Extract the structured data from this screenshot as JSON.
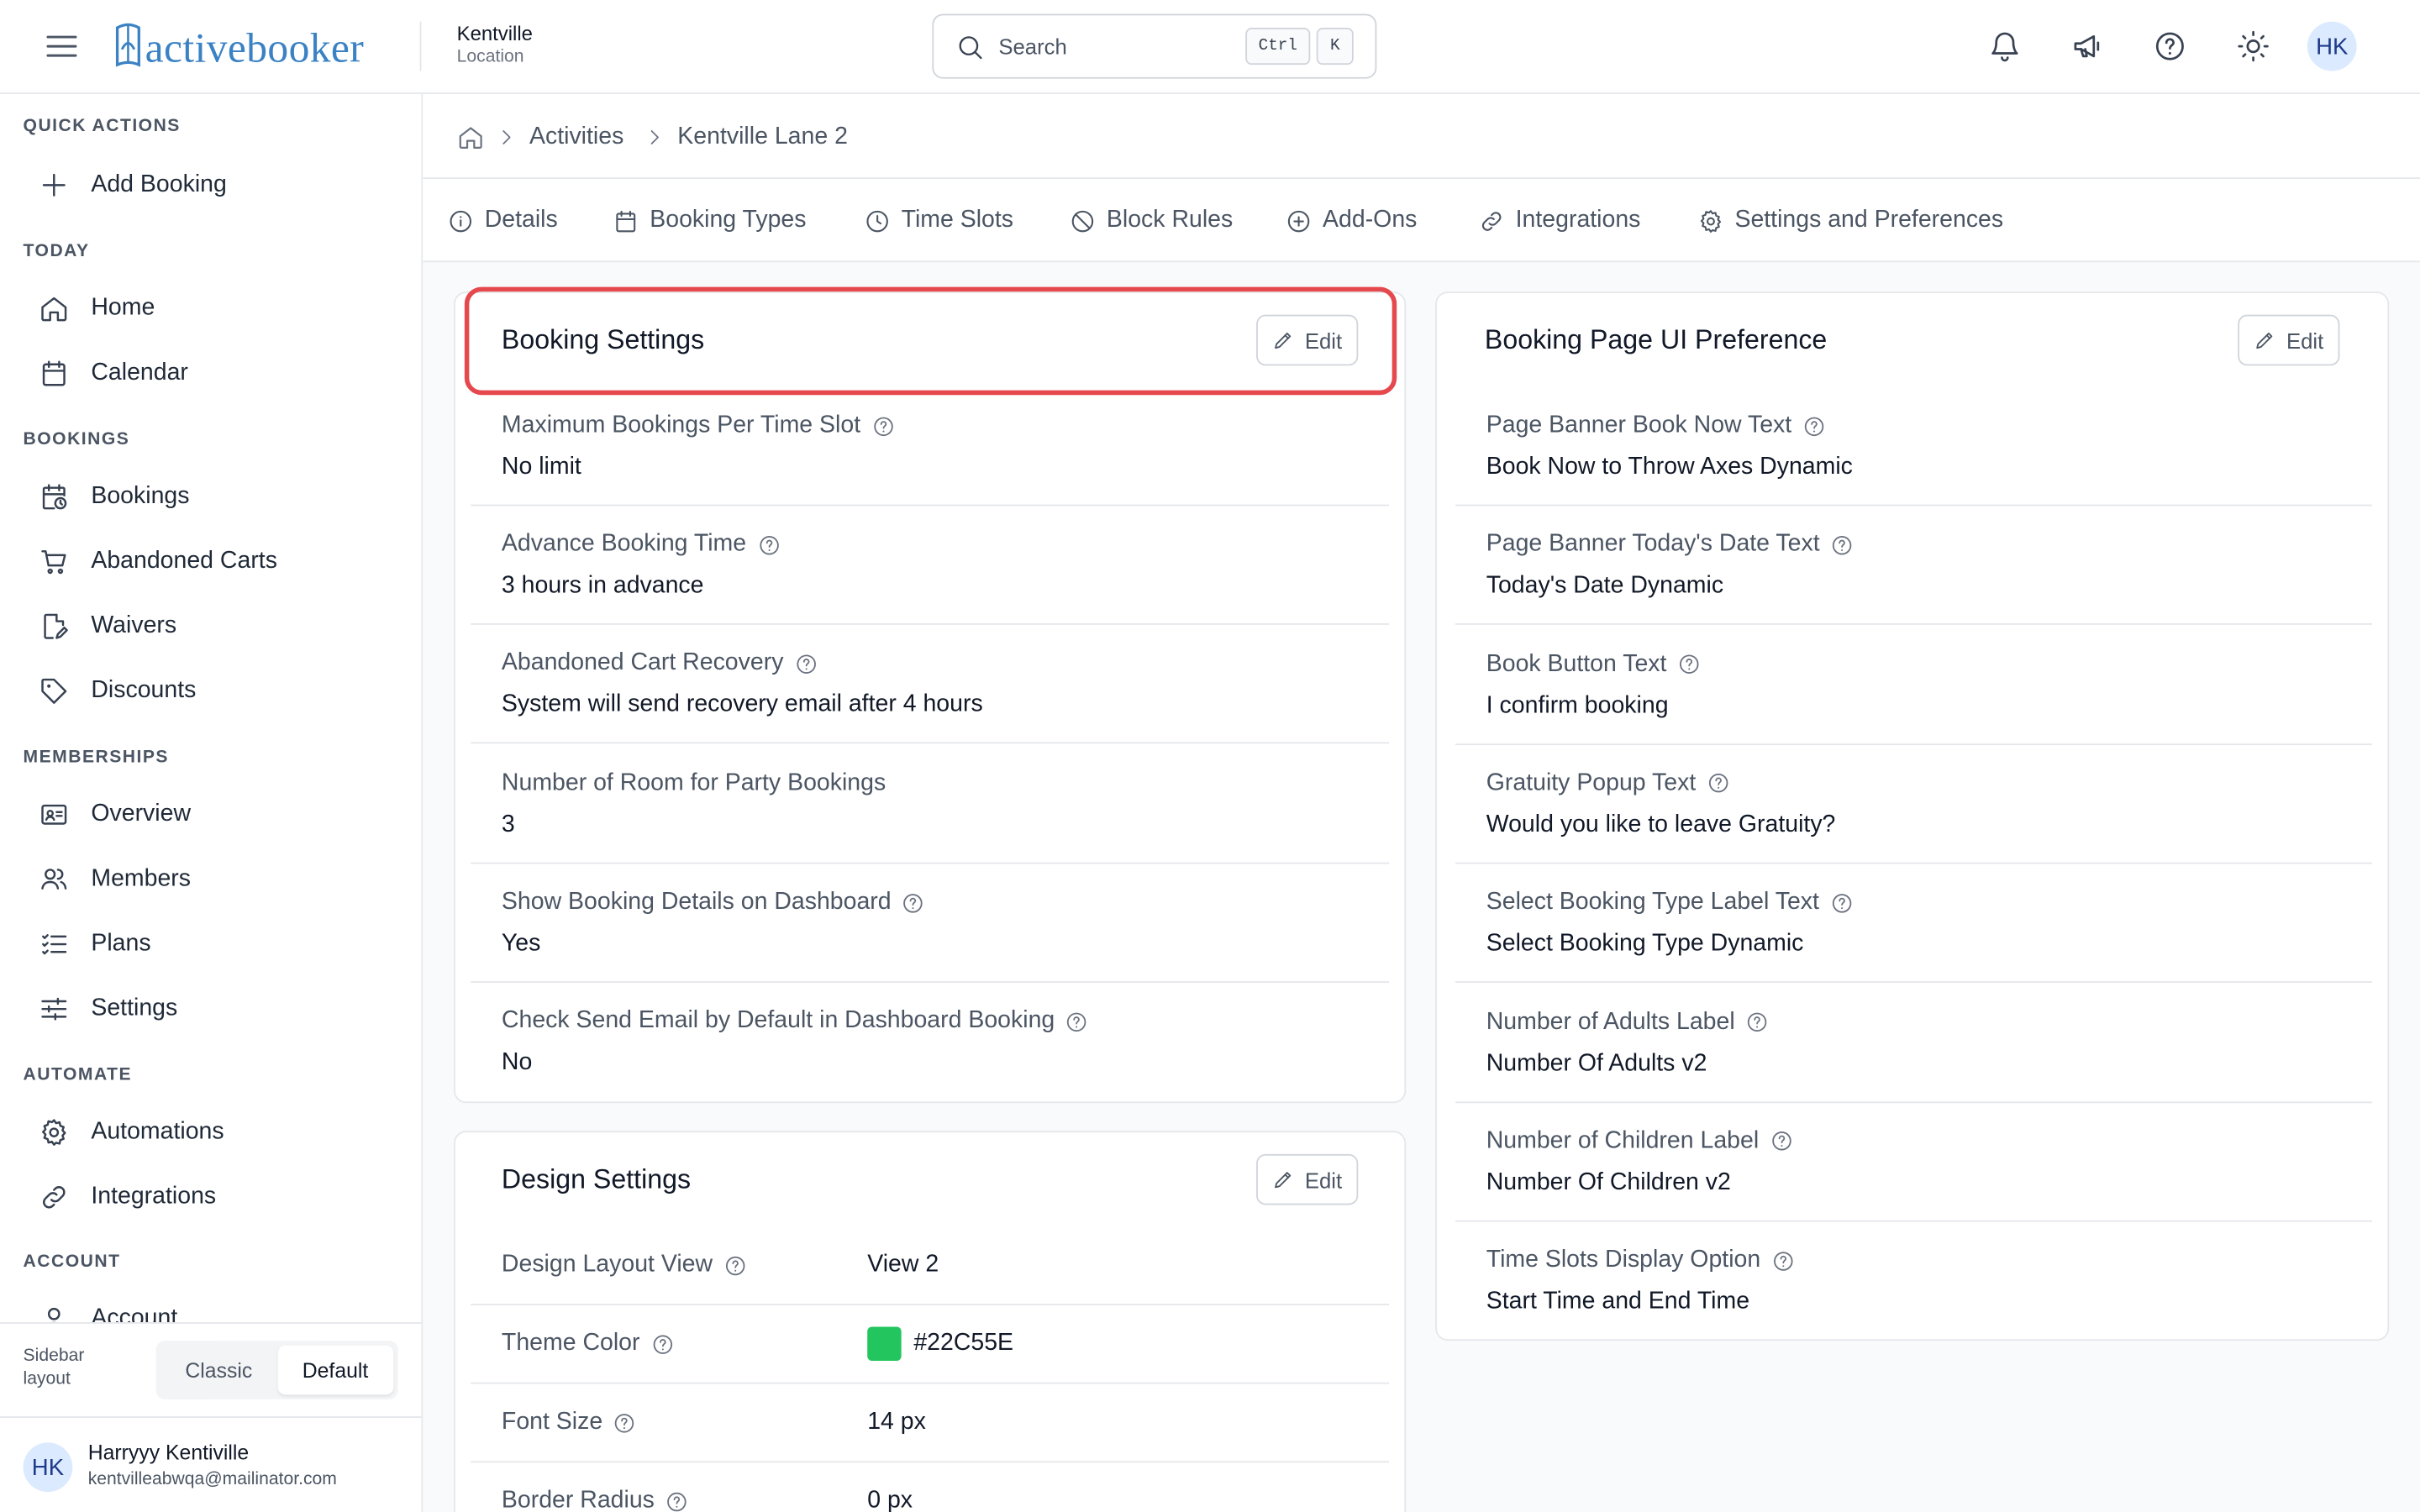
{
  "app": {
    "logo_text": "activebooker",
    "location_name": "Kentville",
    "location_sub": "Location"
  },
  "search": {
    "placeholder": "Search",
    "shortcut_ctrl": "Ctrl",
    "shortcut_key": "K"
  },
  "header": {
    "avatar_initials": "HK",
    "icons": [
      "bell-icon",
      "megaphone-icon",
      "help-circle-icon",
      "sun-icon"
    ]
  },
  "sidebar": {
    "sections": {
      "quick_actions": "QUICK ACTIONS",
      "today": "TODAY",
      "bookings": "BOOKINGS",
      "memberships": "MEMBERSHIPS",
      "automate": "AUTOMATE",
      "account": "ACCOUNT"
    },
    "items": {
      "add_booking": "Add Booking",
      "home": "Home",
      "calendar": "Calendar",
      "bookings": "Bookings",
      "abandoned_carts": "Abandoned Carts",
      "waivers": "Waivers",
      "discounts": "Discounts",
      "overview": "Overview",
      "members": "Members",
      "plans": "Plans",
      "settings": "Settings",
      "automations": "Automations",
      "integrations": "Integrations",
      "account": "Account"
    },
    "layout_label": "Sidebar layout",
    "layout_options": [
      "Classic",
      "Default"
    ],
    "layout_selected": "Default",
    "user": {
      "initials": "HK",
      "name": "Harryyy Kentiville",
      "email": "kentvilleabwqa@mailinator.com"
    }
  },
  "breadcrumb": [
    "Activities",
    "Kentville Lane 2"
  ],
  "tabs": {
    "details": "Details",
    "booking_types": "Booking Types",
    "time_slots": "Time Slots",
    "block_rules": "Block Rules",
    "add_ons": "Add-Ons",
    "integrations": "Integrations",
    "settings_prefs": "Settings and Preferences"
  },
  "booking_settings": {
    "title": "Booking Settings",
    "edit_label": "Edit",
    "rows": [
      {
        "label": "Maximum Bookings Per Time Slot",
        "value": "No limit",
        "help": true
      },
      {
        "label": "Advance Booking Time",
        "value": "3 hours in advance",
        "help": true
      },
      {
        "label": "Abandoned Cart Recovery",
        "value": "System will send recovery email after 4 hours",
        "help": true
      },
      {
        "label": "Number of Room for Party Bookings",
        "value": "3",
        "help": false
      },
      {
        "label": "Show Booking Details on Dashboard",
        "value": "Yes",
        "help": true
      },
      {
        "label": "Check Send Email by Default in Dashboard Booking",
        "value": "No",
        "help": true
      }
    ]
  },
  "design_settings": {
    "title": "Design Settings",
    "edit_label": "Edit",
    "rows": [
      {
        "label": "Design Layout View",
        "value": "View 2"
      },
      {
        "label": "Theme Color",
        "value": "#22C55E",
        "swatch": "#22C55E"
      },
      {
        "label": "Font Size",
        "value": "14 px"
      },
      {
        "label": "Border Radius",
        "value": "0 px"
      }
    ]
  },
  "ui_preference": {
    "title": "Booking Page UI Preference",
    "edit_label": "Edit",
    "rows": [
      {
        "label": "Page Banner Book Now Text",
        "value": "Book Now to Throw Axes Dynamic"
      },
      {
        "label": "Page Banner Today's Date Text",
        "value": "Today's Date Dynamic"
      },
      {
        "label": "Book Button Text",
        "value": "I confirm booking"
      },
      {
        "label": "Gratuity Popup Text",
        "value": "Would you like to leave Gratuity?"
      },
      {
        "label": "Select Booking Type Label Text",
        "value": "Select Booking Type Dynamic"
      },
      {
        "label": "Number of Adults Label",
        "value": "Number Of Adults v2"
      },
      {
        "label": "Number of Children Label",
        "value": "Number Of Children v2"
      },
      {
        "label": "Time Slots Display Option",
        "value": "Start Time and End Time"
      }
    ]
  },
  "colors": {
    "brand": "#3B82C4",
    "highlight": "#E5484D",
    "theme_swatch": "#22C55E"
  }
}
